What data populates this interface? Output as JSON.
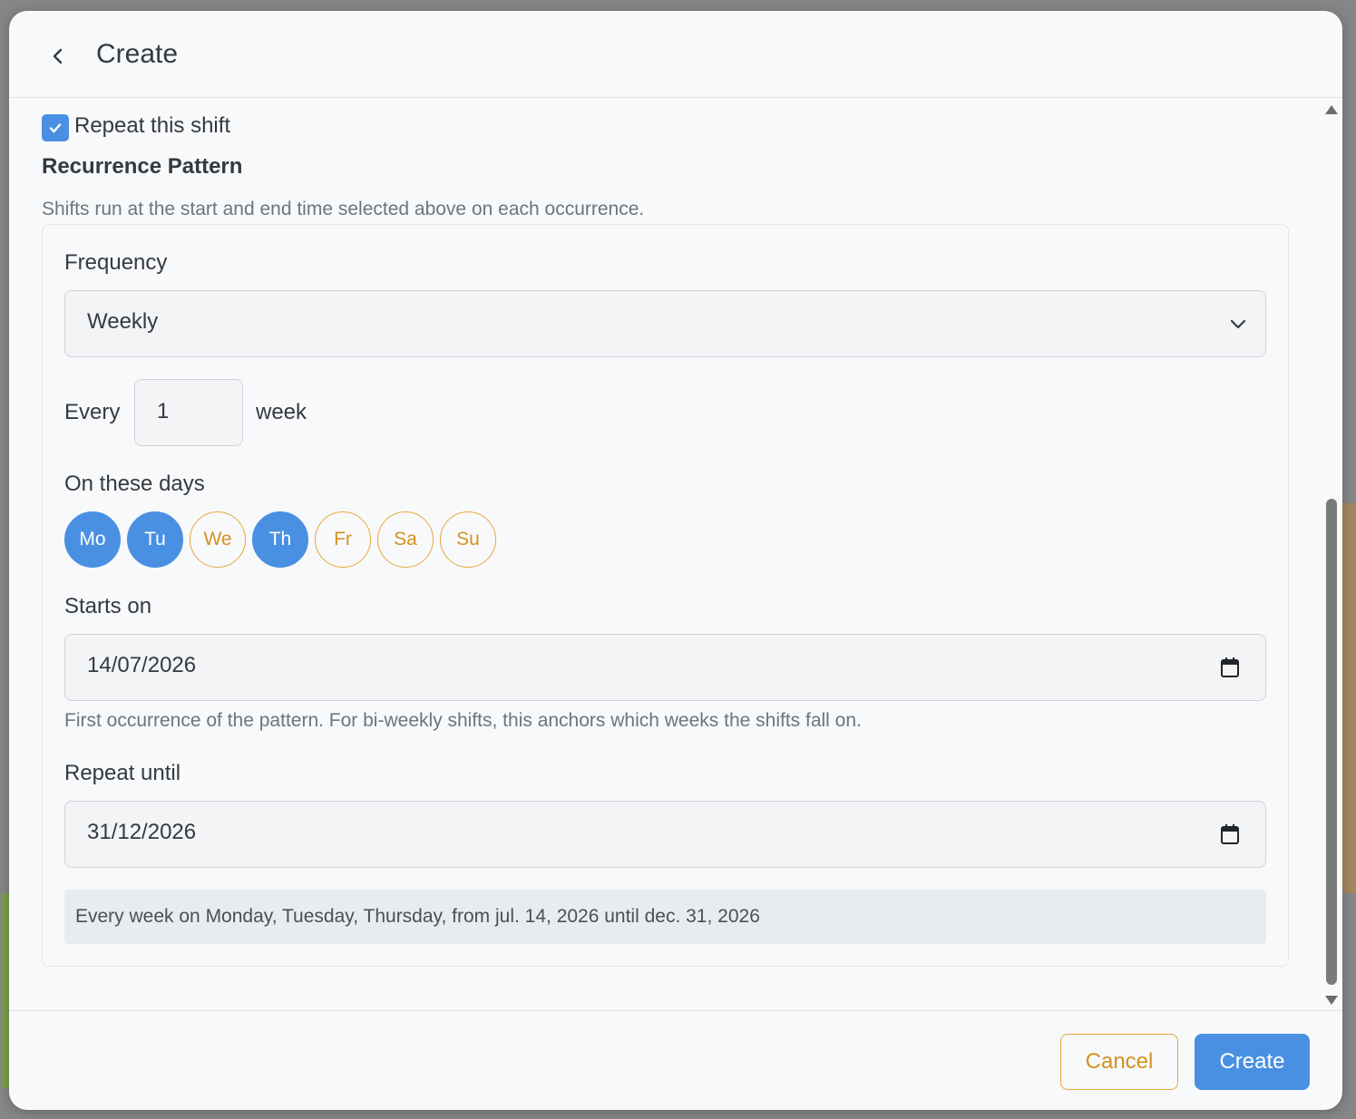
{
  "header": {
    "title": "Create"
  },
  "repeat": {
    "label": "Repeat this shift",
    "checked": true
  },
  "recurrence": {
    "title": "Recurrence Pattern",
    "description": "Shifts run at the start and end time selected above on each occurrence.",
    "frequency_label": "Frequency",
    "frequency_value": "Weekly",
    "every_label": "Every",
    "every_value": "1",
    "every_unit": "week",
    "days_label": "On these days",
    "days": [
      {
        "label": "Mo",
        "selected": true
      },
      {
        "label": "Tu",
        "selected": true
      },
      {
        "label": "We",
        "selected": false
      },
      {
        "label": "Th",
        "selected": true
      },
      {
        "label": "Fr",
        "selected": false
      },
      {
        "label": "Sa",
        "selected": false
      },
      {
        "label": "Su",
        "selected": false
      }
    ],
    "starts_label": "Starts on",
    "starts_value": "14/07/2026",
    "starts_hint": "First occurrence of the pattern. For bi-weekly shifts, this anchors which weeks the shifts fall on.",
    "until_label": "Repeat until",
    "until_value": "31/12/2026",
    "summary": "Every week on Monday, Tuesday, Thursday, from jul. 14, 2026 until dec. 31, 2026"
  },
  "footer": {
    "cancel_label": "Cancel",
    "create_label": "Create"
  },
  "colors": {
    "primary": "#4a90e2",
    "accent": "#e8a73c",
    "text": "#343a40",
    "muted": "#6c757d"
  }
}
